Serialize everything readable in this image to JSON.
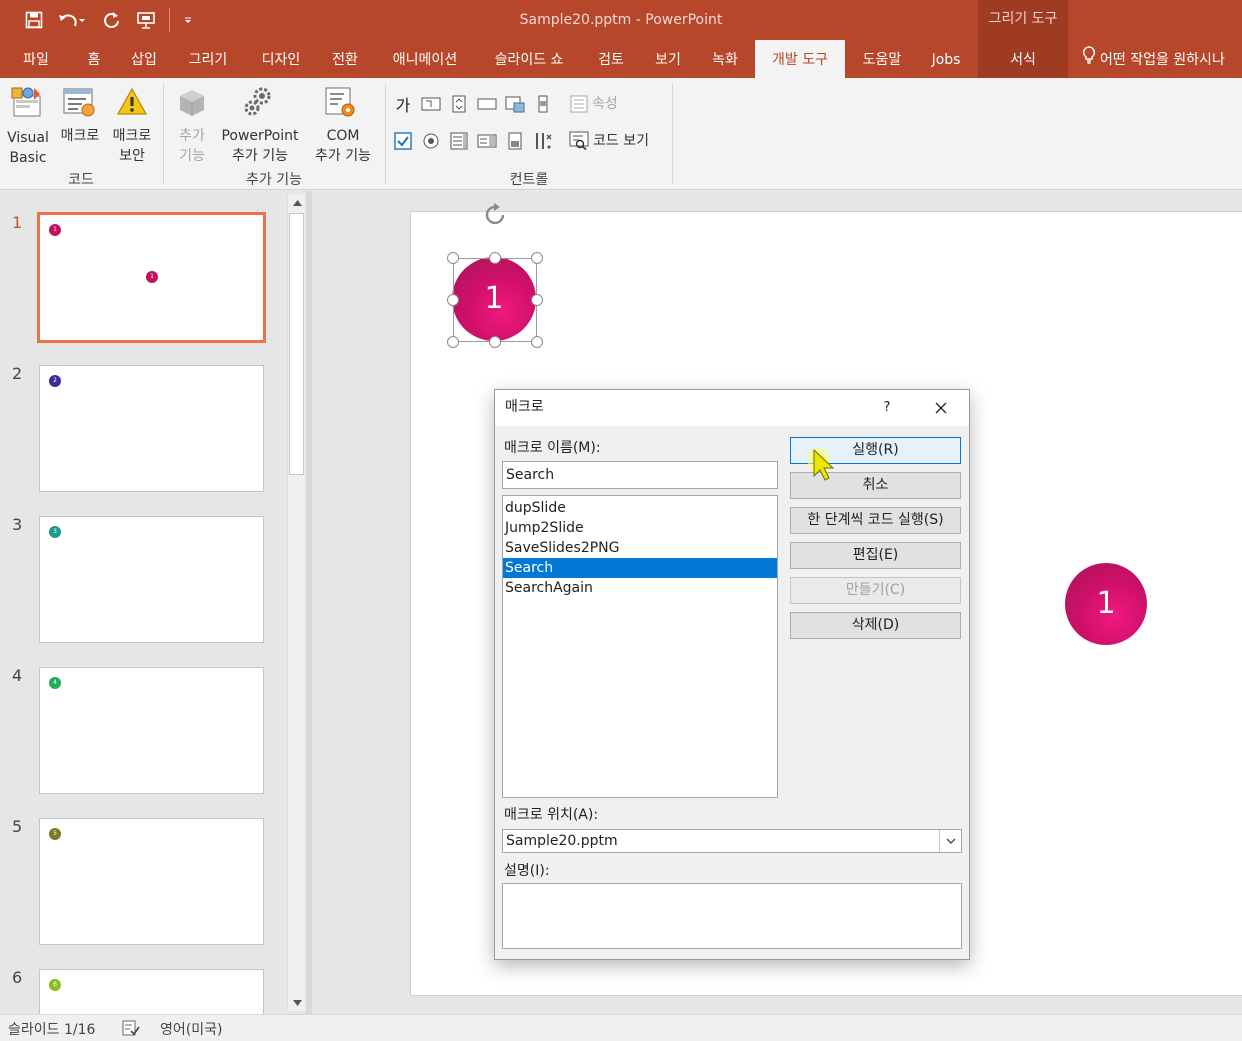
{
  "title_bar": {
    "document_title": "Sample20.pptm  -  PowerPoint",
    "context_group": "그리기 도구",
    "quick_access": [
      "save-icon",
      "undo-icon",
      "redo-icon",
      "slideshow-from-start-icon",
      "customize-qat-icon"
    ]
  },
  "tabs": [
    {
      "label": "파일"
    },
    {
      "label": "홈"
    },
    {
      "label": "삽입"
    },
    {
      "label": "그리기"
    },
    {
      "label": "디자인"
    },
    {
      "label": "전환"
    },
    {
      "label": "애니메이션"
    },
    {
      "label": "슬라이드 쇼"
    },
    {
      "label": "검토"
    },
    {
      "label": "보기"
    },
    {
      "label": "녹화"
    },
    {
      "label": "개발 도구"
    },
    {
      "label": "도움말"
    },
    {
      "label": "Jobs"
    },
    {
      "label": "서식"
    }
  ],
  "tell_me": "어떤 작업을 원하시나",
  "ribbon": {
    "code_group": {
      "title": "코드",
      "visual_basic": [
        "Visual",
        "Basic"
      ],
      "macros": [
        "매크로"
      ],
      "macro_security": [
        "매크로",
        "보안"
      ]
    },
    "addins_group": {
      "title": "추가 기능",
      "addins": [
        "추가",
        "기능"
      ],
      "powerpoint_addins": [
        "PowerPoint",
        "추가 기능"
      ],
      "com_addins": [
        "COM",
        "추가 기능"
      ]
    },
    "controls_group": {
      "title": "컨트롤",
      "label_glyph": "가",
      "properties": "속성",
      "view_code": "코드 보기"
    }
  },
  "slides": [
    {
      "number": "1",
      "dot_label": "1",
      "color": "#c2125e"
    },
    {
      "number": "2",
      "dot_label": "2",
      "color": "#3b2c9a"
    },
    {
      "number": "3",
      "dot_label": "3",
      "color": "#1a9c8e"
    },
    {
      "number": "4",
      "dot_label": "4",
      "color": "#1fae5e"
    },
    {
      "number": "5",
      "dot_label": "5",
      "color": "#7e7a22"
    },
    {
      "number": "6",
      "dot_label": "6",
      "color": "#8fbf1e"
    }
  ],
  "slide_canvas": {
    "selected_shape_label": "1",
    "second_shape_label": "1"
  },
  "status_bar": {
    "slide_indicator": "슬라이드 1/16",
    "language": "영어(미국)"
  },
  "dialog": {
    "title": "매크로",
    "help": "?",
    "name_label": "매크로 이름(M):",
    "name_value": "Search",
    "macros": [
      "dupSlide",
      "Jump2Slide",
      "SaveSlides2PNG",
      "Search",
      "SearchAgain"
    ],
    "selected_macro": "Search",
    "buttons": {
      "run": "실행(R)",
      "cancel": "취소",
      "step_into": "한 단계씩 코드 실행(S)",
      "edit": "편집(E)",
      "create": "만들기(C)",
      "delete": "삭제(D)"
    },
    "location_label": "매크로 위치(A):",
    "location_value": "Sample20.pptm",
    "description_label": "설명(I):",
    "description_value": ""
  }
}
